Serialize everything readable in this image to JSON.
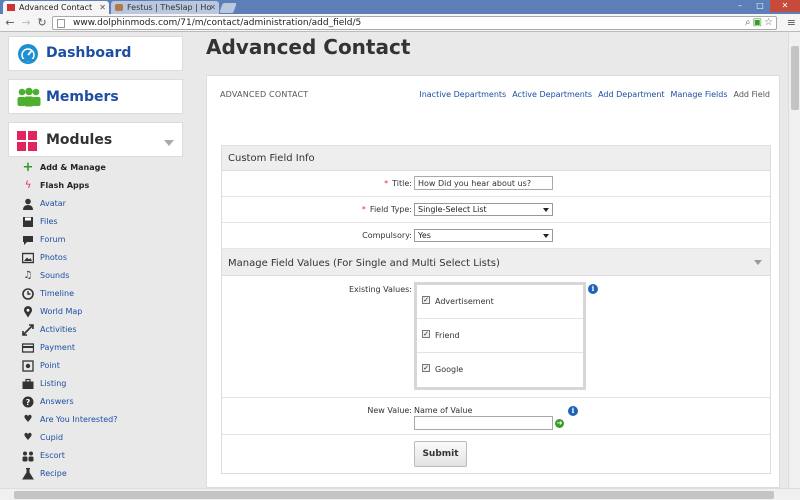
{
  "browser": {
    "tabs": [
      {
        "title": "Advanced Contact"
      },
      {
        "title": "Festus | TheSlap | Ho"
      }
    ],
    "url": "www.dolphinmods.com/71/m/contact/administration/add_field/5"
  },
  "sidebar": {
    "dashboard_label": "Dashboard",
    "members_label": "Members",
    "modules_label": "Modules",
    "module_items": [
      {
        "label": "Add & Manage",
        "icon": "plus-icon"
      },
      {
        "label": "Flash Apps",
        "icon": "lightning-icon"
      },
      {
        "label": "Avatar",
        "icon": "user-icon"
      },
      {
        "label": "Files",
        "icon": "floppy-icon"
      },
      {
        "label": "Forum",
        "icon": "chat-icon"
      },
      {
        "label": "Photos",
        "icon": "photo-icon"
      },
      {
        "label": "Sounds",
        "icon": "music-icon"
      },
      {
        "label": "Timeline",
        "icon": "clock-icon"
      },
      {
        "label": "World Map",
        "icon": "pin-icon"
      },
      {
        "label": "Activities",
        "icon": "arrows-icon"
      },
      {
        "label": "Payment",
        "icon": "card-icon"
      },
      {
        "label": "Point",
        "icon": "point-icon"
      },
      {
        "label": "Listing",
        "icon": "briefcase-icon"
      },
      {
        "label": "Answers",
        "icon": "question-icon"
      },
      {
        "label": "Are You Interested?",
        "icon": "heart-icon"
      },
      {
        "label": "Cupid",
        "icon": "heart-icon"
      },
      {
        "label": "Escort",
        "icon": "group-icon"
      },
      {
        "label": "Recipe",
        "icon": "flask-icon"
      }
    ]
  },
  "main": {
    "page_title": "Advanced Contact",
    "panel_title": "ADVANCED CONTACT",
    "links": [
      "Inactive Departments",
      "Active Departments",
      "Add Department",
      "Manage Fields",
      "Add Field"
    ],
    "section1_title": "Custom Field Info",
    "title_label": "Title:",
    "title_value": "How Did you hear about us?",
    "type_label": "Field Type:",
    "type_value": "Single-Select List",
    "compulsory_label": "Compulsory:",
    "compulsory_value": "Yes",
    "section2_title": "Manage Field Values (For Single and Multi Select Lists)",
    "existing_label": "Existing Values:",
    "existing_values": [
      "Advertisement",
      "Friend",
      "Google"
    ],
    "new_value_label": "New Value:",
    "new_value_hint": "Name of Value",
    "submit_label": "Submit"
  },
  "colors": {
    "brand_blue": "#1d4ea3",
    "dashboard_icon": "#1e8fd1",
    "members_icon": "#4caf2d",
    "modules_icon": "#e0245e"
  }
}
